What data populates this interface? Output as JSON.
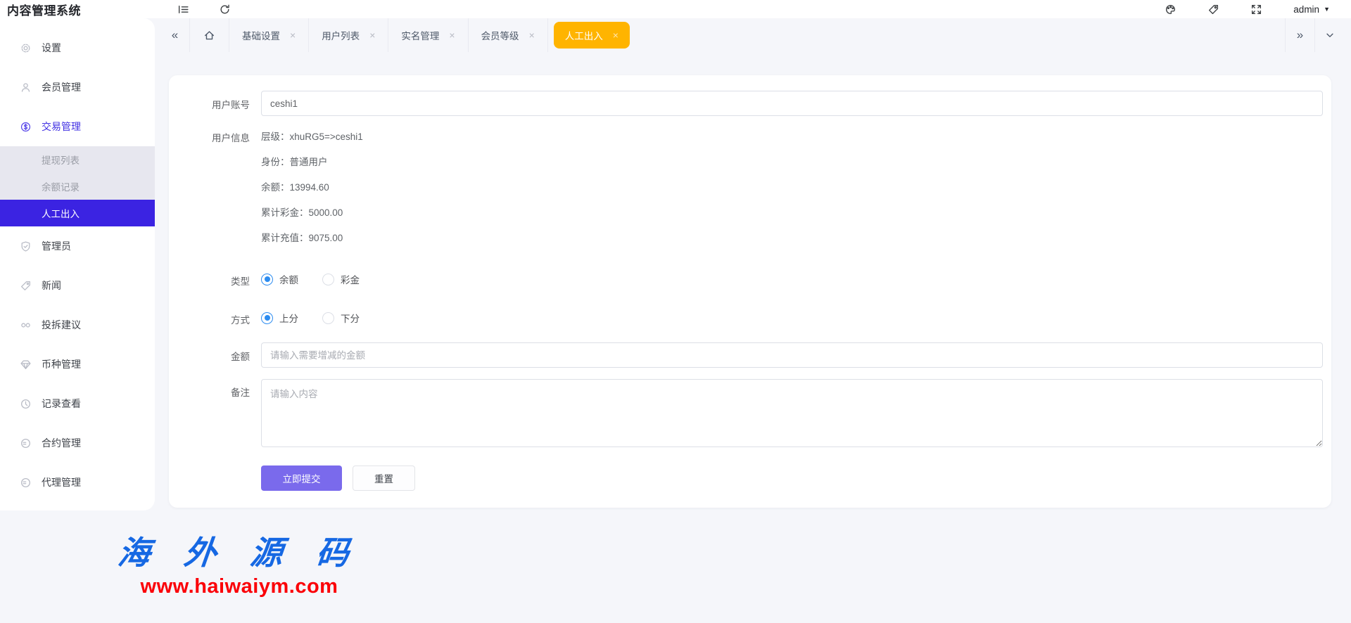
{
  "app": {
    "title": "内容管理系统"
  },
  "topbar": {
    "user": "admin",
    "caret": "▼"
  },
  "sidebar": {
    "items": [
      {
        "label": "设置",
        "icon": "gear"
      },
      {
        "label": "会员管理",
        "icon": "user"
      },
      {
        "label": "交易管理",
        "icon": "dollar-circle"
      },
      {
        "label": "提现列表"
      },
      {
        "label": "余额记录"
      },
      {
        "label": "人工出入"
      },
      {
        "label": "管理员",
        "icon": "shield-check"
      },
      {
        "label": "新闻",
        "icon": "tag"
      },
      {
        "label": "投拆建议",
        "icon": "infinity"
      },
      {
        "label": "币种管理",
        "icon": "gem"
      },
      {
        "label": "记录查看",
        "icon": "history"
      },
      {
        "label": "合约管理",
        "icon": "contract"
      },
      {
        "label": "代理管理",
        "icon": "agent"
      }
    ]
  },
  "tabbar": {
    "collapse": "«",
    "expand": "»",
    "close_glyph": "×",
    "tabs": [
      {
        "label": "基础设置"
      },
      {
        "label": "用户列表"
      },
      {
        "label": "实名管理"
      },
      {
        "label": "会员等级"
      },
      {
        "label": "人工出入"
      }
    ]
  },
  "form": {
    "account": {
      "label": "用户账号",
      "value": "ceshi1"
    },
    "user_info": {
      "label": "用户信息",
      "lines": [
        "层级：xhuRG5=>ceshi1",
        "身份：普通用户",
        "余额：13994.60",
        "累计彩金：5000.00",
        "累计充值：9075.00"
      ]
    },
    "type": {
      "label": "类型",
      "option_a": "余额",
      "option_b": "彩金",
      "selected": "余额"
    },
    "method": {
      "label": "方式",
      "option_a": "上分",
      "option_b": "下分",
      "selected": "上分"
    },
    "amount": {
      "label": "金额",
      "placeholder": "请输入需要增减的金额"
    },
    "remark": {
      "label": "备注",
      "placeholder": "请输入内容"
    },
    "submit_label": "立即提交",
    "reset_label": "重置"
  },
  "watermark": {
    "brand": "海 外 源 码",
    "url": "www.haiwaiym.com"
  },
  "colors": {
    "sidebar_active": "#3b23e2",
    "parent_active_text": "#4130e3",
    "tab_active": "#ffb400",
    "radio_checked": "#2d8cf0",
    "submit_button": "#7a6aec",
    "page_bg": "#f5f6fa"
  }
}
